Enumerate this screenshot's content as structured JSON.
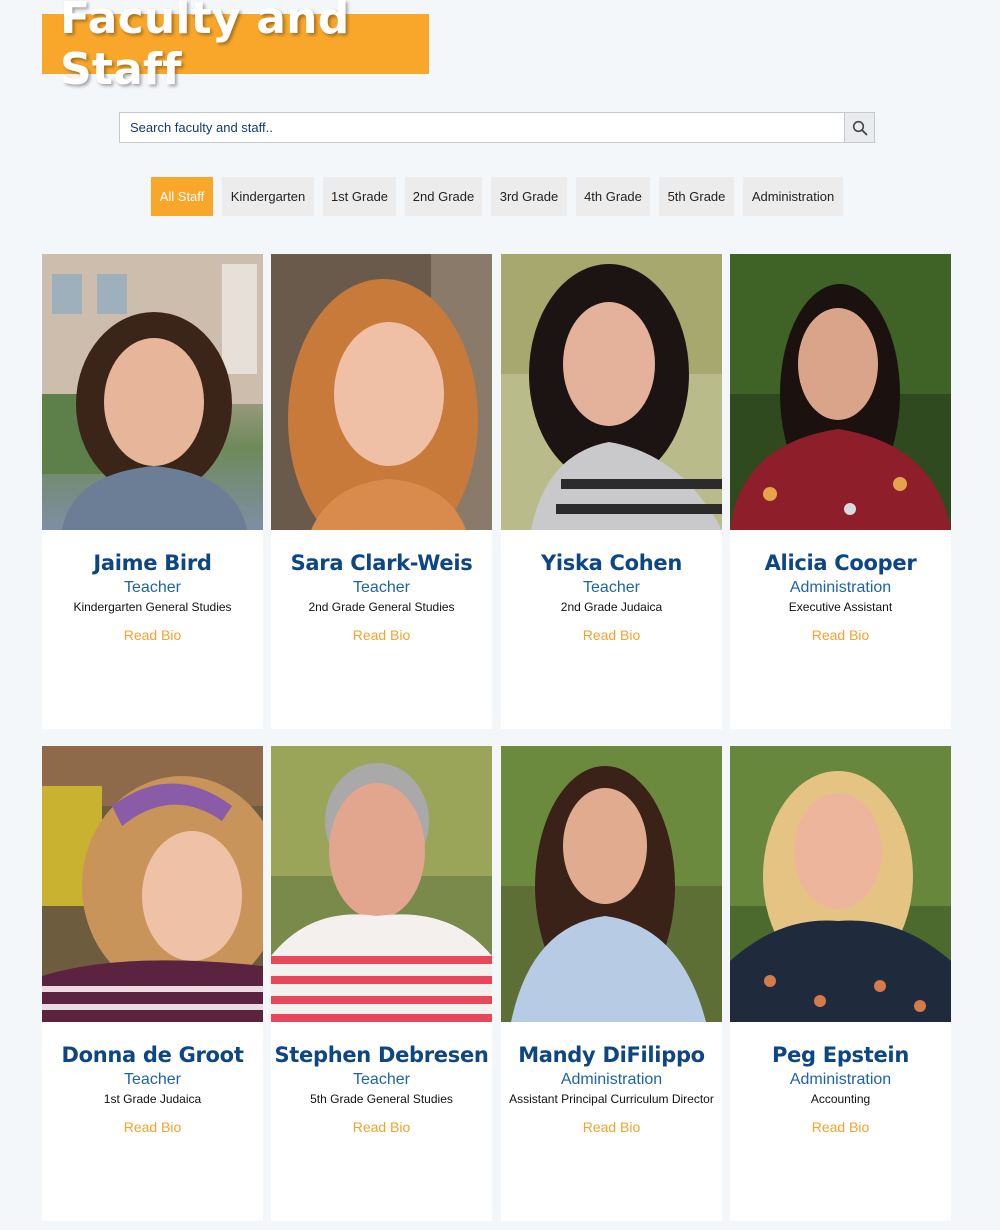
{
  "page_title": "Faculty and Staff",
  "search": {
    "placeholder": "Search faculty and staff..",
    "button_icon": "search-icon"
  },
  "filters": [
    {
      "label": "All Staff",
      "active": true
    },
    {
      "label": "Kindergarten",
      "active": false
    },
    {
      "label": "1st Grade",
      "active": false
    },
    {
      "label": "2nd Grade",
      "active": false
    },
    {
      "label": "3rd Grade",
      "active": false
    },
    {
      "label": "4th Grade",
      "active": false
    },
    {
      "label": "5th Grade",
      "active": false
    },
    {
      "label": "Administration",
      "active": false
    }
  ],
  "colors": {
    "accent": "#f9a72b",
    "name_blue": "#0d4682",
    "role_blue": "#1d64a6",
    "link_orange": "#f2a32c",
    "page_bg": "#f4f7fa"
  },
  "staff": [
    {
      "name": "Jaime Bird",
      "role": "Teacher",
      "dept": "Kindergarten General Studies",
      "link": "Read Bio"
    },
    {
      "name": "Sara Clark-Weis",
      "role": "Teacher",
      "dept": "2nd Grade General Studies",
      "link": "Read Bio"
    },
    {
      "name": "Yiska Cohen",
      "role": "Teacher",
      "dept": "2nd Grade Judaica",
      "link": "Read Bio"
    },
    {
      "name": "Alicia Cooper",
      "role": "Administration",
      "dept": "Executive Assistant",
      "link": "Read Bio"
    },
    {
      "name": "Donna de Groot",
      "role": "Teacher",
      "dept": "1st Grade Judaica",
      "link": "Read Bio"
    },
    {
      "name": "Stephen Debresen",
      "role": "Teacher",
      "dept": "5th Grade General Studies",
      "link": "Read Bio"
    },
    {
      "name": "Mandy DiFilippo",
      "role": "Administration",
      "dept": "Assistant Principal Curriculum Director",
      "link": "Read Bio"
    },
    {
      "name": "Peg Epstein",
      "role": "Administration",
      "dept": "Accounting",
      "link": "Read Bio"
    }
  ]
}
